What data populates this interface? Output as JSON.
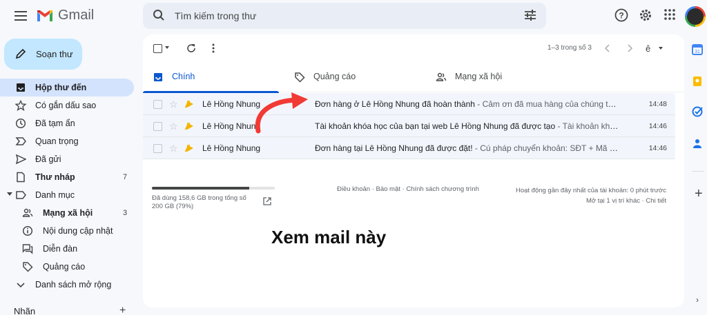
{
  "app": {
    "name": "Gmail"
  },
  "search": {
    "placeholder": "Tìm kiếm trong thư"
  },
  "compose": {
    "label": "Soạn thư"
  },
  "sidebar": {
    "items": [
      {
        "label": "Hộp thư đến",
        "icon": "inbox-icon",
        "active": true,
        "bold": true,
        "count": ""
      },
      {
        "label": "Có gắn dấu sao",
        "icon": "star-icon",
        "count": ""
      },
      {
        "label": "Đã tạm ẩn",
        "icon": "clock-icon",
        "count": ""
      },
      {
        "label": "Quan trọng",
        "icon": "important-icon",
        "count": ""
      },
      {
        "label": "Đã gửi",
        "icon": "send-icon",
        "count": ""
      },
      {
        "label": "Thư nháp",
        "icon": "draft-icon",
        "bold": true,
        "count": "7"
      },
      {
        "label": "Danh mục",
        "icon": "label-icon",
        "count": ""
      },
      {
        "label": "Mạng xã hội",
        "icon": "people-icon",
        "bold": true,
        "sub": true,
        "count": "3"
      },
      {
        "label": "Nội dung cập nhật",
        "icon": "info-icon",
        "sub": true,
        "count": ""
      },
      {
        "label": "Diễn đàn",
        "icon": "forum-icon",
        "sub": true,
        "count": ""
      },
      {
        "label": "Quảng cáo",
        "icon": "tag-icon",
        "sub": true,
        "count": ""
      },
      {
        "label": "Danh sách mở rộng",
        "icon": "chevron-down-icon",
        "count": ""
      }
    ],
    "labels_heading": "Nhãn"
  },
  "toolbar": {
    "pager": "1–3 trong số 3"
  },
  "tabs": [
    {
      "label": "Chính",
      "icon": "inbox-icon",
      "active": true
    },
    {
      "label": "Quảng cáo",
      "icon": "tag-icon"
    },
    {
      "label": "Mạng xã hội",
      "icon": "people-icon"
    }
  ],
  "emails": [
    {
      "sender": "Lê Hồng Nhung",
      "subject": "Đơn hàng ở Lê Hồng Nhung đã hoàn thành",
      "snippet": " - Cảm ơn đã mua hàng của chúng tôi Xi...",
      "time": "14:48"
    },
    {
      "sender": "Lê Hồng Nhung",
      "subject": "Tài khoản khóa học của bạn tại web Lê Hồng Nhung đã được tạo",
      "snippet": " - Tài khoản khóa ...",
      "time": "14:46"
    },
    {
      "sender": "Lê Hồng Nhung",
      "subject": "Đơn hàng tại Lê Hồng Nhung đã được đặt!",
      "snippet": " - Cú pháp chuyển khoản: SĐT + Mã đơn...",
      "time": "14:46"
    }
  ],
  "footer": {
    "storage_text": "Đã dùng 158,6 GB trong tổng số 200 GB (79%)",
    "storage_fraction": 0.79,
    "links": "Điều khoản · Bảo mật · Chính sách chương trình",
    "activity_line1": "Hoạt động gần đây nhất của tài khoản: 0 phút trước",
    "activity_line2": "Mở tại 1 vị trí khác · Chi tiết"
  },
  "annotation": {
    "text": "Xem mail này",
    "arrow_color": "#f23a35"
  },
  "colors": {
    "accent": "#0b57d0",
    "compose_bg": "#c2e7ff",
    "active_nav": "#d3e3fd"
  }
}
